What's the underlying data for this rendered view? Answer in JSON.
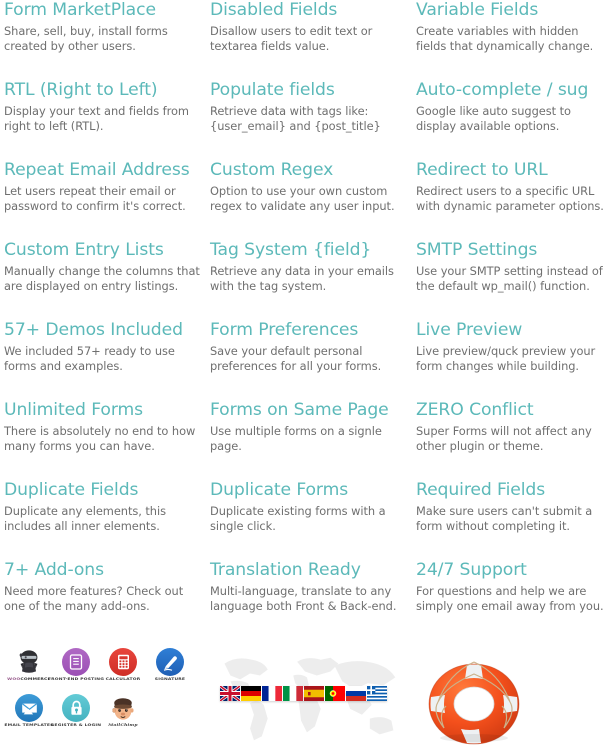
{
  "features": [
    {
      "title": "Form MarketPlace",
      "desc": "Share, sell, buy, install forms created by other users."
    },
    {
      "title": "Disabled Fields",
      "desc": "Disallow users to edit text or textarea fields value."
    },
    {
      "title": "Variable Fields",
      "desc": "Create variables with hidden fields that dynamically change."
    },
    {
      "title": "RTL (Right to Left)",
      "desc": "Display your text and fields from right to left (RTL)."
    },
    {
      "title": "Populate fields",
      "desc": "Retrieve data with tags like: {user_email} and {post_title}"
    },
    {
      "title": "Auto-complete / sug",
      "desc": "Google like auto suggest to display available options."
    },
    {
      "title": "Repeat Email Address",
      "desc": "Let users repeat their email or password to confirm it's correct."
    },
    {
      "title": "Custom Regex",
      "desc": "Option to use your own custom regex to validate any user input."
    },
    {
      "title": "Redirect to URL",
      "desc": "Redirect users to a specific URL with dynamic parameter options."
    },
    {
      "title": "Custom Entry Lists",
      "desc": "Manually change the columns that are displayed on entry listings."
    },
    {
      "title": "Tag System {field}",
      "desc": "Retrieve any data in your emails with the tag system."
    },
    {
      "title": "SMTP Settings",
      "desc": "Use your SMTP setting instead of the default wp_mail() function."
    },
    {
      "title": "57+ Demos Included",
      "desc": "We included 57+ ready to use forms and examples."
    },
    {
      "title": "Form Preferences",
      "desc": "Save your default personal preferences for all your forms."
    },
    {
      "title": "Live Preview",
      "desc": "Live preview/quck preview your form changes while building."
    },
    {
      "title": "Unlimited Forms",
      "desc": "There is absolutely no end to how many forms you can have."
    },
    {
      "title": "Forms on Same Page",
      "desc": "Use multiple forms on a signle page."
    },
    {
      "title": "ZERO Conflict",
      "desc": "Super Forms will not affect any other plugin or theme."
    },
    {
      "title": "Duplicate Fields",
      "desc": "Duplicate any elements, this includes all inner elements."
    },
    {
      "title": "Duplicate Forms",
      "desc": "Duplicate existing forms with a single click."
    },
    {
      "title": "Required Fields",
      "desc": "Make sure users can't submit a form without completing it."
    },
    {
      "title": "7+ Add-ons",
      "desc": "Need more features? Check out one of the many add-ons."
    },
    {
      "title": "Translation Ready",
      "desc": "Multi-language, translate to any language both Front & Back-end."
    },
    {
      "title": "24/7 Support",
      "desc": "For questions and help we are simply one email away from you."
    }
  ],
  "addons": [
    {
      "icon": "woocommerce-ninja-icon",
      "label": "WOO COMMERCE",
      "label_woo": "WOO",
      "label_rest": "COMMERCE"
    },
    {
      "icon": "front-end-posting-icon",
      "label": "FRONT-END POSTING"
    },
    {
      "icon": "calculator-icon",
      "label": "CALCULATOR"
    },
    {
      "icon": "signature-pen-icon",
      "label": "SIGNATURE"
    },
    {
      "icon": "email-templates-icon",
      "label": "EMAIL TEMPLATES"
    },
    {
      "icon": "register-login-lock-icon",
      "label": "REGISTER & LOGIN"
    },
    {
      "icon": "mailchimp-monkey-icon",
      "label": "MailChimp"
    }
  ],
  "flags": [
    {
      "name": "united-kingdom-flag"
    },
    {
      "name": "germany-flag"
    },
    {
      "name": "france-flag"
    },
    {
      "name": "italy-flag"
    },
    {
      "name": "spain-flag"
    },
    {
      "name": "portugal-flag"
    },
    {
      "name": "russia-flag"
    },
    {
      "name": "greece-flag"
    }
  ],
  "media": {
    "world_map": "world-map-graphic",
    "lifebuoy": "lifebuoy-support-icon"
  },
  "colors": {
    "heading": "#5cb9b9",
    "body": "#6f6f6f",
    "background": "#ffffff"
  }
}
